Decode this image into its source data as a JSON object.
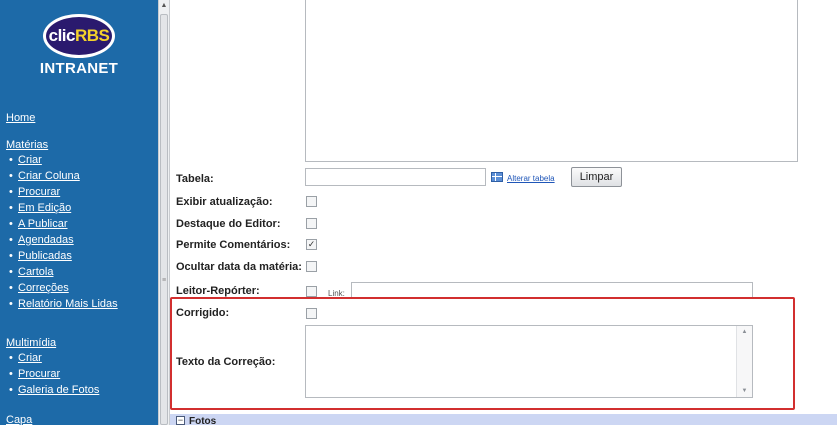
{
  "sidebar": {
    "logo": {
      "clic": "clic",
      "rbs": "RBS",
      "caption": "INTRANET"
    },
    "home": "Home",
    "sections": [
      {
        "title": "Matérias",
        "items": [
          "Criar",
          "Criar Coluna",
          "Procurar",
          "Em Edição",
          "A Publicar",
          "Agendadas",
          "Publicadas",
          "Cartola",
          "Correções",
          "Relatório Mais Lidas"
        ]
      },
      {
        "title": "Multimídia",
        "items": [
          "Criar",
          "Procurar",
          "Galeria de Fotos"
        ]
      },
      {
        "title": "Capa",
        "items": []
      }
    ],
    "bullet": "•"
  },
  "form": {
    "tabela_label": "Tabela:",
    "tabela_value": "",
    "alterar_tabela": "Alterar tabela",
    "limpar_button": "Limpar",
    "exibir_label": "Exibir atualização:",
    "exibir_checked": false,
    "destaque_label": "Destaque do Editor:",
    "destaque_checked": false,
    "permite_label": "Permite Comentários:",
    "permite_checked": true,
    "ocultar_label": "Ocultar data da matéria:",
    "ocultar_checked": false,
    "leitor_label": "Leitor-Repórter:",
    "leitor_checked": false,
    "link_label": "Link:",
    "link_value": "",
    "corrigido_label": "Corrigido:",
    "corrigido_checked": false,
    "texto_correcao_label": "Texto da Correção:",
    "texto_correcao_value": "",
    "check_glyph": "✓"
  },
  "fotos_section": {
    "toggle": "−",
    "label": "Fotos"
  },
  "colors": {
    "sidebar_bg": "#1d6aa8",
    "highlight_border": "#d22f2f",
    "fotos_bar": "#ccd6f3"
  }
}
